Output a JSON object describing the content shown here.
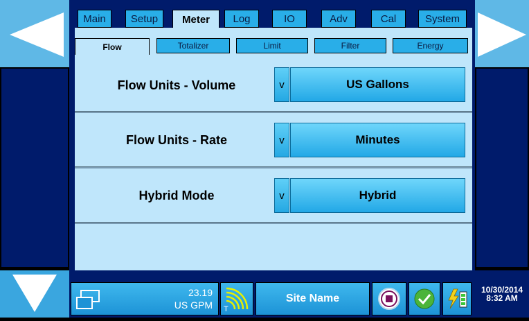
{
  "tabs": [
    {
      "label": "Main"
    },
    {
      "label": "Setup"
    },
    {
      "label": "Meter"
    },
    {
      "label": "Log"
    },
    {
      "label": "IO"
    },
    {
      "label": "Adv"
    },
    {
      "label": "Cal"
    },
    {
      "label": "System"
    }
  ],
  "active_tab": "Meter",
  "subtabs": [
    {
      "label": "Flow"
    },
    {
      "label": "Totalizer"
    },
    {
      "label": "Limit"
    },
    {
      "label": "Filter"
    },
    {
      "label": "Energy"
    }
  ],
  "active_subtab": "Flow",
  "settings": [
    {
      "label": "Flow Units - Volume",
      "dropdown_symbol": "v",
      "value": "US Gallons"
    },
    {
      "label": "Flow Units - Rate",
      "dropdown_symbol": "v",
      "value": "Minutes"
    },
    {
      "label": "Hybrid Mode",
      "dropdown_symbol": "v",
      "value": "Hybrid"
    }
  ],
  "status": {
    "flow_value": "23.19",
    "flow_unit": "US GPM",
    "signal_label": "T",
    "site_name": "Site Name",
    "date": "10/30/2014",
    "time": "8:32 AM"
  },
  "icons": {
    "left_arrow": "left-arrow-icon",
    "right_arrow": "right-arrow-icon",
    "down_arrow": "down-arrow-icon",
    "display": "display-icon",
    "signal": "signal-icon",
    "stop": "stop-icon",
    "ok": "checkmark-icon",
    "power": "power-icon"
  },
  "colors": {
    "accent": "#29aee8",
    "panel": "#bfe6fb",
    "frame": "#001b6b",
    "side_arrow_bg": "#5fb8e6"
  }
}
